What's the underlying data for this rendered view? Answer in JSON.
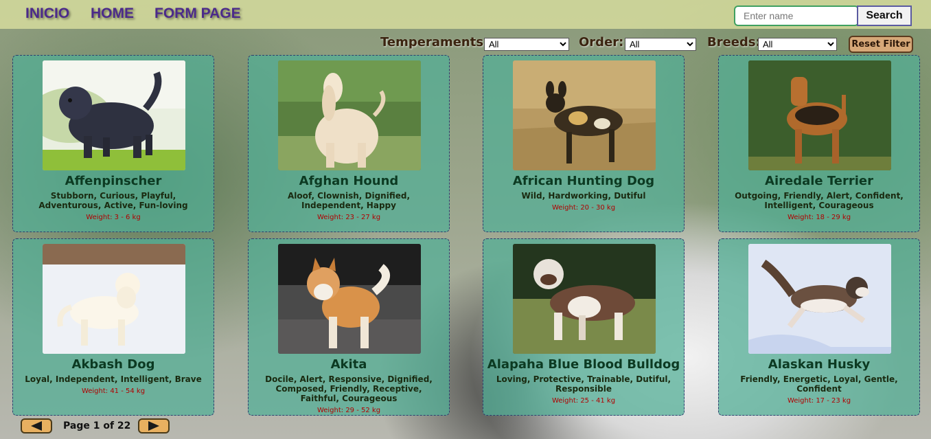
{
  "nav": {
    "links": [
      "INICIO",
      "HOME",
      "FORM PAGE"
    ]
  },
  "search": {
    "placeholder": "Enter name",
    "value": "",
    "button_label": "Search"
  },
  "filters": {
    "temperaments": {
      "label": "Temperaments:",
      "selected": "All"
    },
    "order": {
      "label": "Order:",
      "selected": "All"
    },
    "breeds": {
      "label": "Breeds:",
      "selected": "All"
    },
    "reset_label": "Reset Filter"
  },
  "dogs": [
    {
      "name": "Affenpinscher",
      "temperament": "Stubborn, Curious, Playful, Adventurous, Active, Fun-loving",
      "weight": "Weight: 3 - 6 kg",
      "photo": "black shaggy dog on grass"
    },
    {
      "name": "Afghan Hound",
      "temperament": "Aloof, Clownish, Dignified, Independent, Happy",
      "weight": "Weight: 23 - 27 kg",
      "photo": "long-haired cream hound in forest"
    },
    {
      "name": "African Hunting Dog",
      "temperament": "Wild, Hardworking, Dutiful",
      "weight": "Weight: 20 - 30 kg",
      "photo": "spotted wild dog in dry grass"
    },
    {
      "name": "Airedale Terrier",
      "temperament": "Outgoing, Friendly, Alert, Confident, Intelligent, Courageous",
      "weight": "Weight: 18 - 29 kg",
      "photo": "tan and black terrier by hedge"
    },
    {
      "name": "Akbash Dog",
      "temperament": "Loyal, Independent, Intelligent, Brave",
      "weight": "Weight: 41 - 54 kg",
      "photo": "white dog in snow"
    },
    {
      "name": "Akita",
      "temperament": "Docile, Alert, Responsive, Dignified, Composed, Friendly, Receptive, Faithful, Courageous",
      "weight": "Weight: 29 - 52 kg",
      "photo": "orange and white akita"
    },
    {
      "name": "Alapaha Blue Blood Bulldog",
      "temperament": "Loving, Protective, Trainable, Dutiful, Responsible",
      "weight": "Weight: 25 - 41 kg",
      "photo": "brown and white bulldog on lawn"
    },
    {
      "name": "Alaskan Husky",
      "temperament": "Friendly, Energetic, Loyal, Gentle, Confident",
      "weight": "Weight: 17 - 23 kg",
      "photo": "husky running in snow"
    }
  ],
  "pagination": {
    "label": "Page 1 of 22",
    "current": 1,
    "total": 22
  },
  "colors": {
    "nav_link": "#4b2a8a",
    "card_bg": "#50af96",
    "weight_text": "#b00000",
    "reset_button": "#d6a878",
    "pager_button": "#e8b060"
  }
}
